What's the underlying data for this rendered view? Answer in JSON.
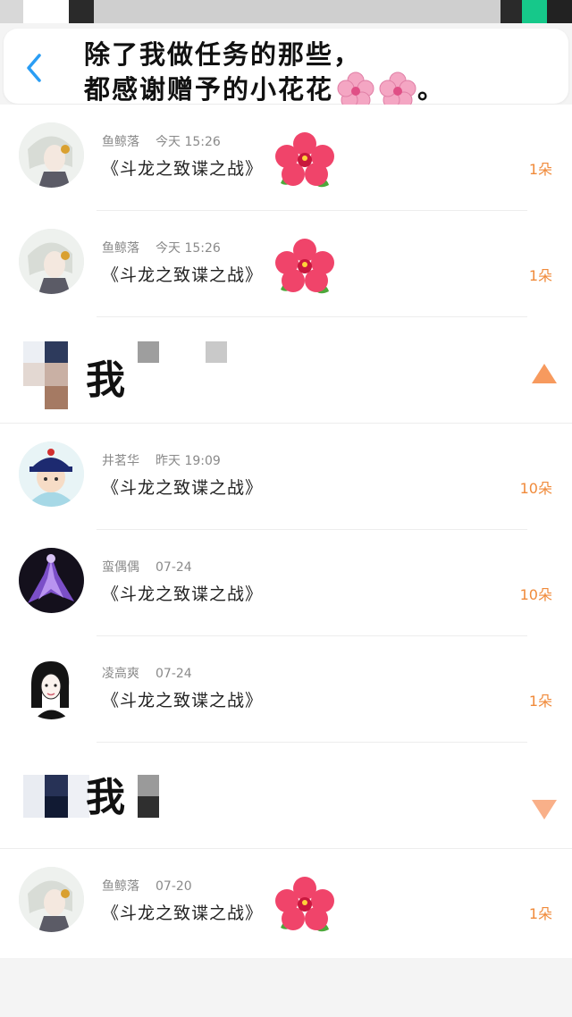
{
  "header": {
    "title_line1": "除了我做任务的那些，",
    "title_line2": "都感谢赠予的小花花",
    "title_end": "。"
  },
  "colors": {
    "accent_blue": "#2a9df4",
    "count_orange": "#f08a3a",
    "arrow_orange": "#f79a5e"
  },
  "items": [
    {
      "name": "鱼鲸落",
      "time": "今天 15:26",
      "book": "《斗龙之致谍之战》",
      "count": "1朵",
      "avatar": "white-haired-character",
      "has_flower": true
    },
    {
      "name": "鱼鲸落",
      "time": "今天 15:26",
      "book": "《斗龙之致谍之战》",
      "count": "1朵",
      "avatar": "white-haired-character",
      "has_flower": true
    },
    {
      "name": "井茗华",
      "time": "昨天 19:09",
      "book": "《斗龙之致谍之战》",
      "count": "10朵",
      "avatar": "qing-official-cartoon",
      "has_flower": false
    },
    {
      "name": "蛮偶偶",
      "time": "07-24",
      "book": "《斗龙之致谍之战》",
      "count": "10朵",
      "avatar": "purple-dancer",
      "has_flower": false
    },
    {
      "name": "凌高爽",
      "time": "07-24",
      "book": "《斗龙之致谍之战》",
      "count": "1朵",
      "avatar": "sketch-girl",
      "has_flower": false
    },
    {
      "name": "鱼鲸落",
      "time": "07-20",
      "book": "《斗龙之致谍之战》",
      "count": "1朵",
      "avatar": "white-haired-character",
      "has_flower": true
    }
  ],
  "sections": [
    {
      "label": "我",
      "arrow": "up-arrow-icon"
    },
    {
      "label": "我",
      "arrow": "down-arrow-icon"
    }
  ]
}
